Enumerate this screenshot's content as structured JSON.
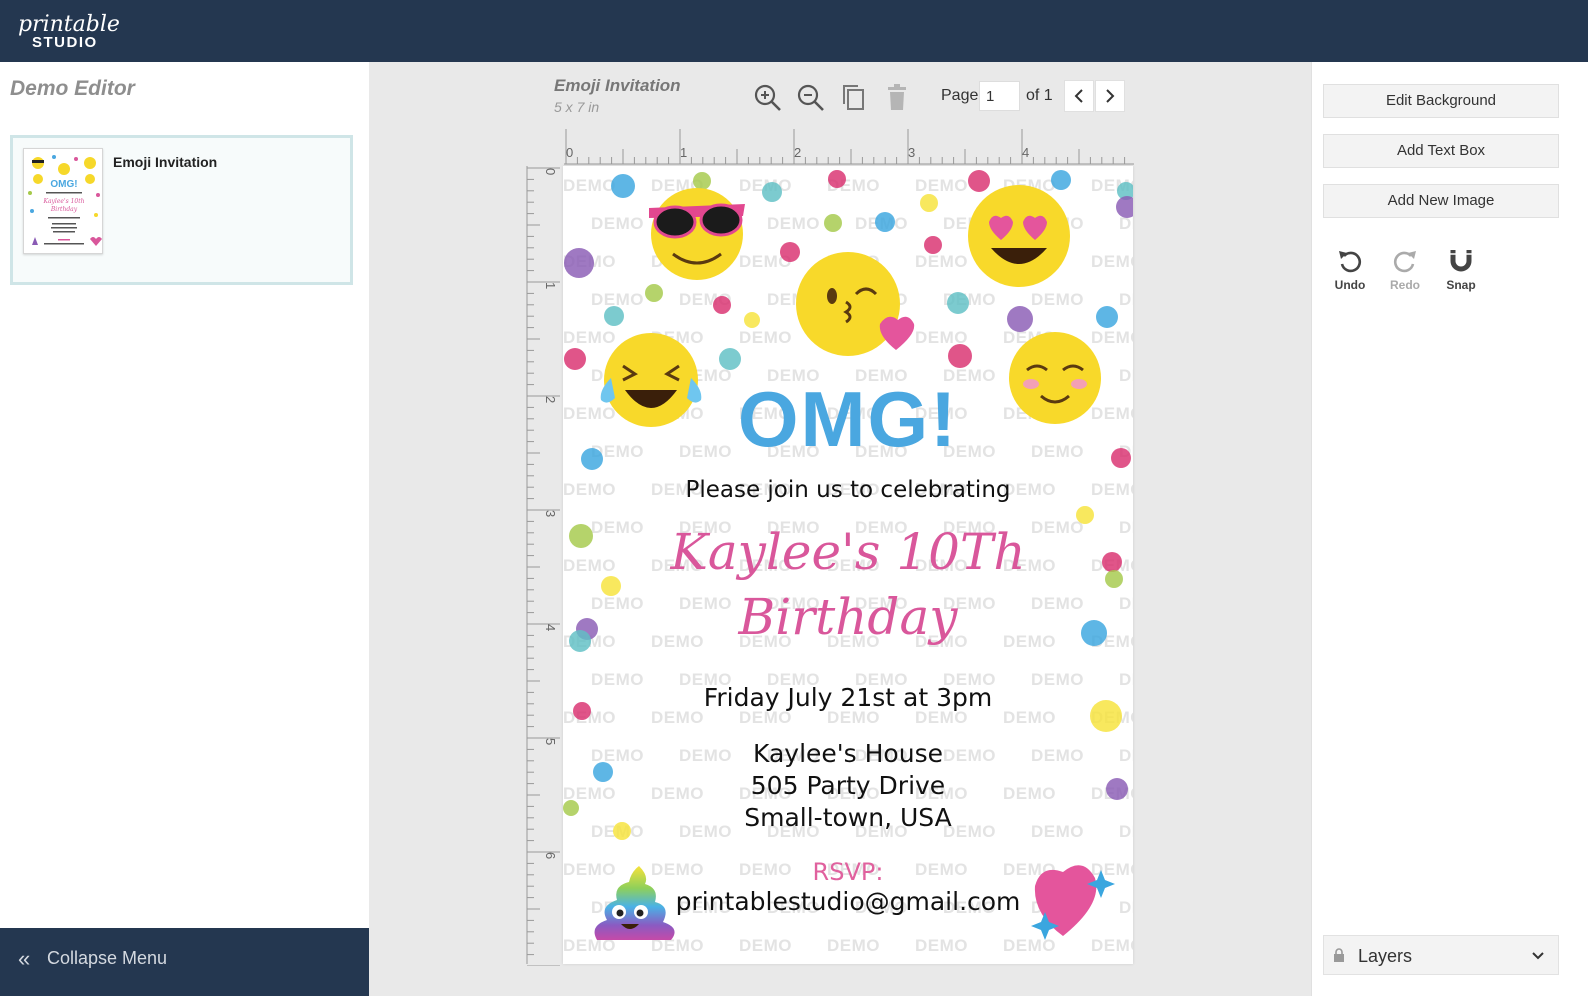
{
  "header": {
    "logo_script": "printable",
    "logo_word": "STUDIO"
  },
  "sidebar": {
    "title": "Demo Editor",
    "templates": [
      {
        "name": "Emoji Invitation"
      }
    ],
    "collapse_label": "Collapse Menu"
  },
  "toolbar": {
    "doc_title": "Emoji Invitation",
    "doc_size": "5 x 7 in",
    "icons": [
      "zoom-in-icon",
      "zoom-out-icon",
      "copy-icon",
      "trash-icon",
      "chevron-left-icon",
      "chevron-right-icon"
    ],
    "page_label": "Page",
    "page_value": "1",
    "of_label": "of 1"
  },
  "rulers": {
    "horizontal": [
      "0",
      "1",
      "2",
      "3",
      "4"
    ],
    "vertical": [
      "0",
      "1",
      "2",
      "3",
      "4",
      "5",
      "6"
    ]
  },
  "invitation": {
    "headline": "OMG!",
    "line1": "Please join us to celebrating",
    "name_line": "Kaylee's 10Th",
    "name_line2": "Birthday",
    "when": "Friday July 21st at 3pm",
    "address": [
      "Kaylee's House",
      "505 Party Drive",
      "Small-town, USA"
    ],
    "rsvp_label": "RSVP:",
    "rsvp_email": "printablestudio@gmail.com",
    "watermark": "DEMO",
    "colors": {
      "headline": "#4aa7e0",
      "script": "#d9579b",
      "rsvp": "#e0619e"
    }
  },
  "right_panel": {
    "buttons": [
      "Edit Background",
      "Add Text Box",
      "Add New Image"
    ],
    "tools": [
      {
        "label": "Undo",
        "icon": "undo-icon",
        "enabled": true
      },
      {
        "label": "Redo",
        "icon": "redo-icon",
        "enabled": false
      },
      {
        "label": "Snap",
        "icon": "magnet-icon",
        "enabled": true
      }
    ],
    "layers_label": "Layers"
  }
}
